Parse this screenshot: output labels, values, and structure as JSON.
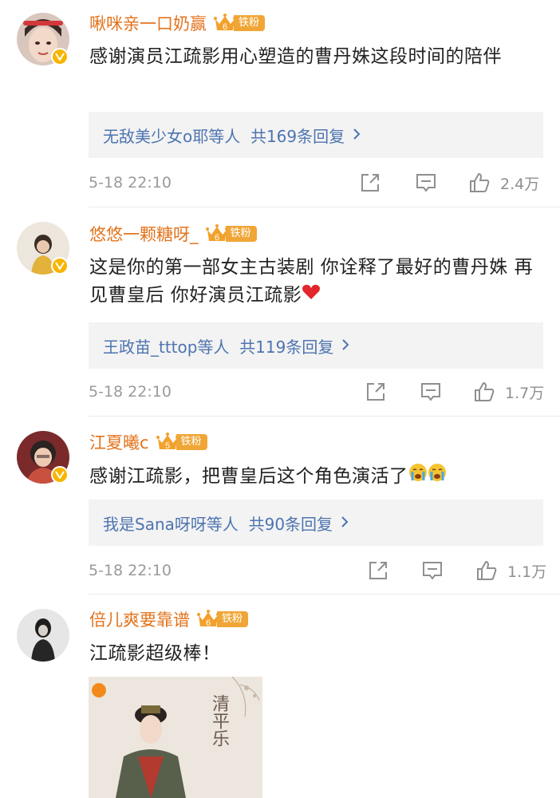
{
  "comments": [
    {
      "username": "啾咪亲一口奶赢",
      "fan_level": "6",
      "fan_tag": "铁粉",
      "text": "感谢演员江疏影用心塑造的曹丹姝这段时间的陪伴",
      "reply_summary": "无敌美少女o耶等人  共169条回复",
      "time": "5-18 22:10",
      "likes": "2.4万"
    },
    {
      "username": "悠悠一颗糖呀_",
      "fan_level": "6",
      "fan_tag": "铁粉",
      "text": "这是你的第一部女主古装剧 你诠释了最好的曹丹姝 再见曹皇后 你好演员江疏影",
      "reply_summary": "王政苗_tttop等人  共119条回复",
      "time": "5-18 22:10",
      "likes": "1.7万"
    },
    {
      "username": "江夏曦c",
      "fan_level": "5",
      "fan_tag": "铁粉",
      "text": "感谢江疏影，把曹皇后这个角色演活了",
      "reply_summary": "我是Sana呀呀等人  共90条回复",
      "time": "5-18 22:10",
      "likes": "1.1万"
    },
    {
      "username": "倍儿爽要靠谱",
      "fan_level": "6",
      "fan_tag": "铁粉",
      "text": "江疏影超级棒！",
      "poster_title": "清平乐"
    }
  ],
  "icons": {
    "share": "share-icon",
    "comment": "comment-icon",
    "like": "thumbs-up-icon",
    "verified": "verified-badge-icon",
    "crown": "crown-icon",
    "heart": "heart-emoji",
    "cry": "crying-emoji"
  },
  "colors": {
    "username": "#e3731c",
    "link": "#4d74b0",
    "badge": "#f0a636",
    "verified": "#f7b500"
  }
}
